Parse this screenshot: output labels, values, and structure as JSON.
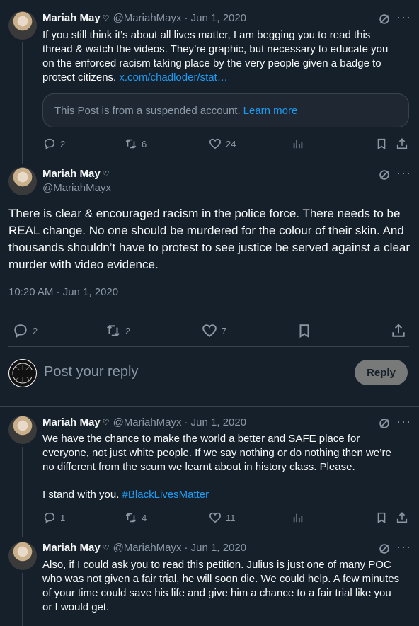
{
  "tweet1": {
    "name": "Mariah May",
    "handle": "@MariahMayx",
    "date": "· Jun 1, 2020",
    "text": "If you still think it’s about all lives matter, I am begging you to read this thread & watch the videos. They’re graphic, but necessary to educate you on the enforced racism taking place by the very people given a badge to protect citizens.",
    "link": "x.com/chadloder/stat…",
    "quote_notice": "This Post is from a suspended account.",
    "quote_learn_more": "Learn more",
    "replies": "2",
    "reposts": "6",
    "likes": "24"
  },
  "main": {
    "name": "Mariah May",
    "handle": "@MariahMayx",
    "text": "There is clear & encouraged racism in the police force. There needs to be REAL change. No one should be murdered for the colour of their skin. And thousands shouldn’t have to protest to see justice be served against a clear murder with video evidence.",
    "timestamp": "10:20 AM · Jun 1, 2020",
    "replies": "2",
    "reposts": "2",
    "likes": "7"
  },
  "reply_box": {
    "placeholder": "Post your reply",
    "button": "Reply"
  },
  "tweet3": {
    "name": "Mariah May",
    "handle": "@MariahMayx",
    "date": "· Jun 1, 2020",
    "text": "We have the chance to make the world a better and SAFE place for everyone, not just white people. If we say nothing or do nothing then we’re no different from the scum we learnt about in history class. Please.",
    "text2": "I stand with you.",
    "hashtag": "#BlackLivesMatter",
    "replies": "1",
    "reposts": "4",
    "likes": "11"
  },
  "tweet4": {
    "name": "Mariah May",
    "handle": "@MariahMayx",
    "date": "· Jun 1, 2020",
    "text": "Also, if I could ask you to read this petition. Julius is just one of many POC who was not given a fair trial, he will soon die. We could help. A few minutes of your time could save his life and give him a chance to a fair trial like you or I would get."
  }
}
